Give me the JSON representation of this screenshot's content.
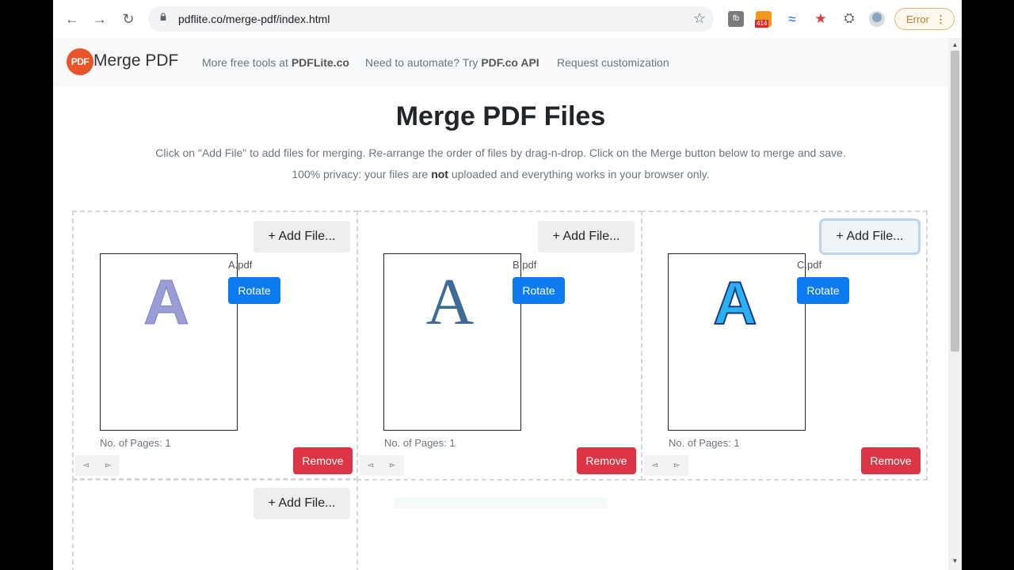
{
  "browser": {
    "url": "pdflite.co/merge-pdf/index.html",
    "badge_count": "414",
    "error_label": "Error"
  },
  "nav": {
    "logo_text": "PDF",
    "brand": "Merge PDF",
    "link1_prefix": "More free tools at ",
    "link1_bold": "PDFLite.co",
    "link2_prefix": "Need to automate? Try ",
    "link2_bold": "PDF.co API",
    "link3": "Request customization"
  },
  "main": {
    "title": "Merge PDF Files",
    "desc1": "Click on \"Add File\" to add files for merging. Re-arrange the order of files by drag-n-drop. Click on the Merge button below to merge and save.",
    "desc2_pre": "100% privacy: your files are ",
    "desc2_bold": "not",
    "desc2_post": " uploaded and everything works in your browser only."
  },
  "files": [
    {
      "add_label": "+ Add File...",
      "name": "A.pdf",
      "rotate": "Rotate",
      "pages": "No. of Pages: 1",
      "remove": "Remove",
      "glyph": "A",
      "glyph_color": "#9b9ed6"
    },
    {
      "add_label": "+ Add File...",
      "name": "B.pdf",
      "rotate": "Rotate",
      "pages": "No. of Pages: 1",
      "remove": "Remove",
      "glyph": "A",
      "glyph_color": "#3d6a97"
    },
    {
      "add_label": "+ Add File...",
      "name": "C.pdf",
      "rotate": "Rotate",
      "pages": "No. of Pages: 1",
      "remove": "Remove",
      "glyph": "A",
      "glyph_color": "#2bb2ee"
    }
  ],
  "empty_slot": {
    "add_label": "+ Add File..."
  },
  "arrows": {
    "left": "◅",
    "right": "▻"
  }
}
